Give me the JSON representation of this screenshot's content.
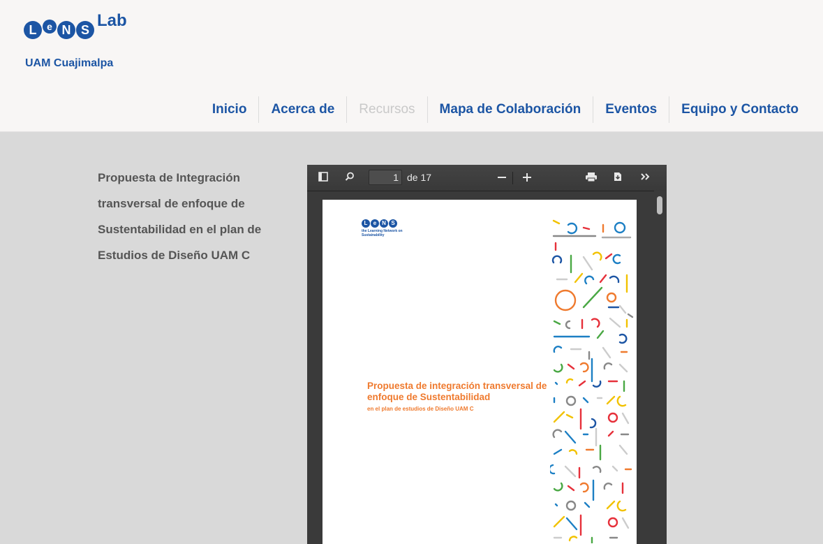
{
  "logo": {
    "letters": [
      "L",
      "e",
      "N",
      "S"
    ],
    "lab": "Lab",
    "subtitle": "UAM Cuajimalpa"
  },
  "nav": {
    "items": [
      {
        "label": "Inicio",
        "active": true
      },
      {
        "label": "Acerca de",
        "active": true
      },
      {
        "label": "Recursos",
        "active": false
      },
      {
        "label": "Mapa de Colaboración",
        "active": true
      },
      {
        "label": "Eventos",
        "active": true
      },
      {
        "label": "Equipo y Contacto",
        "active": true
      }
    ]
  },
  "document": {
    "title_lines": [
      "Propuesta de Integración",
      "transversal de enfoque de",
      "Sustentabilidad en el plan de",
      "Estudios de Diseño UAM C"
    ]
  },
  "viewer": {
    "page_number": "1",
    "page_of": "de 17",
    "icons": {
      "sidebar": "sidebar-toggle-icon",
      "search": "search-icon",
      "zoom_out": "zoom-out-icon",
      "zoom_in": "zoom-in-icon",
      "print": "print-icon",
      "download": "download-icon",
      "more": "more-tools-icon"
    },
    "page": {
      "logo_tag": "the Learning Network on Sustainability",
      "cover_title": "Propuesta de integración transversal de enfoque de Sustentabilidad",
      "cover_subtitle": "en el plan de estudios de Diseño UAM C"
    }
  },
  "colors": {
    "brand_blue": "#1c55a4",
    "cover_orange": "#ef7a2e",
    "background": "#d9d9d9"
  }
}
